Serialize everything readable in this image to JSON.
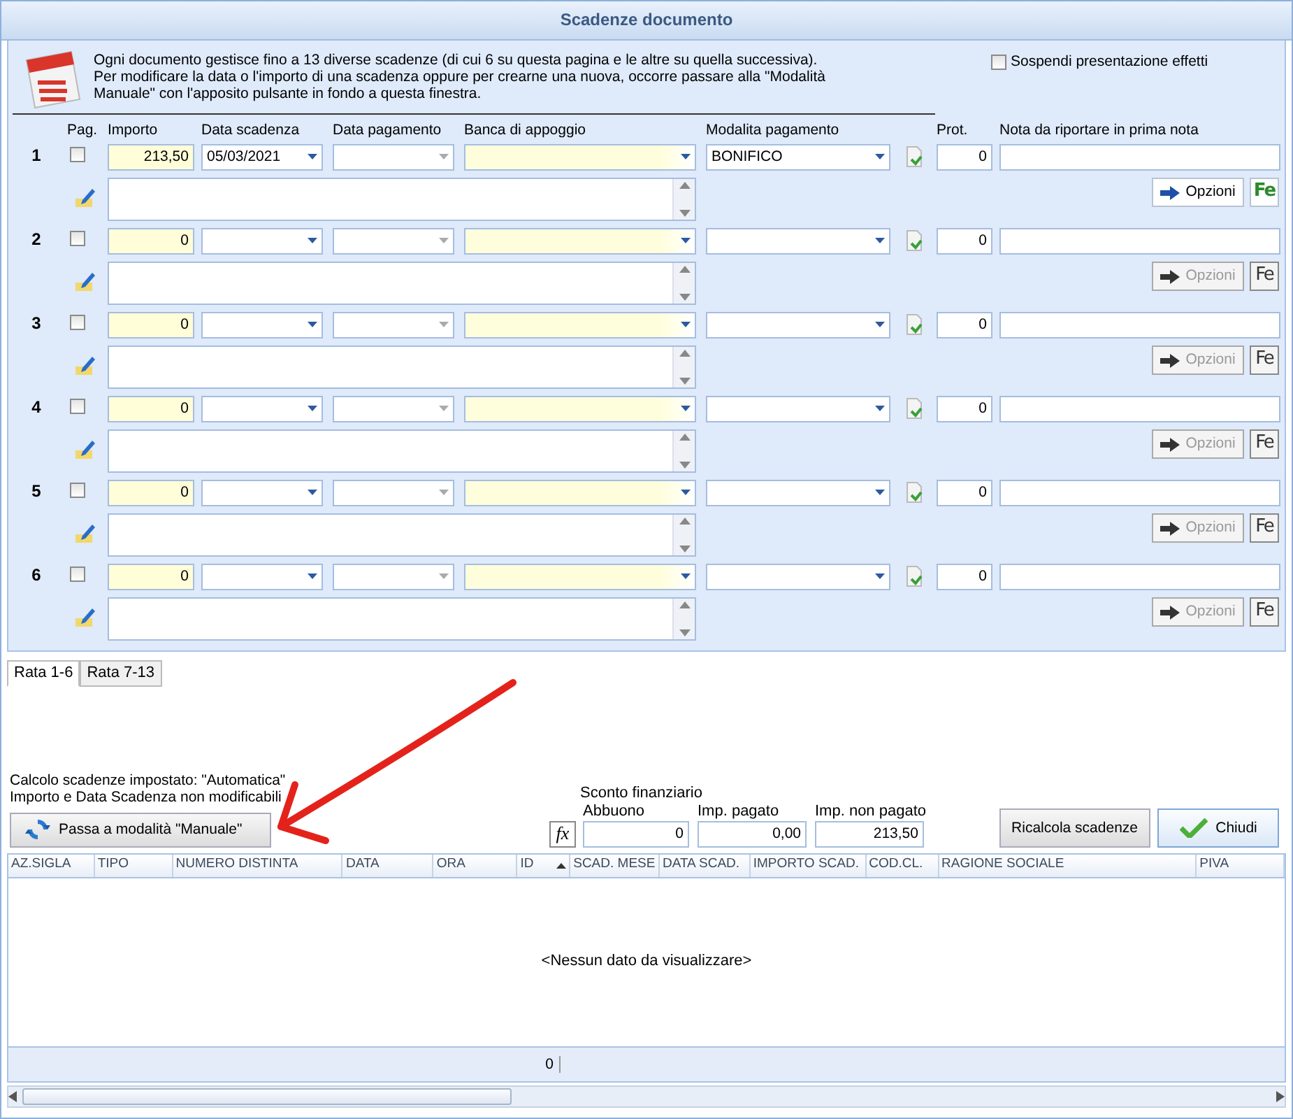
{
  "window": {
    "title": "Scadenze documento"
  },
  "info": {
    "lines": [
      "Ogni documento gestisce fino a 13 diverse scadenze (di cui 6 su questa pagina e le altre su quella successiva).",
      "Per modificare la data o l'importo di una scadenza oppure per crearne una nuova, occorre passare alla \"Modalità",
      "Manuale\" con l'apposito pulsante in fondo a questa finestra."
    ]
  },
  "suspend_checkbox": {
    "label": "Sospendi presentazione effetti",
    "checked": false
  },
  "columns": [
    "Pag.",
    "Importo",
    "Data scadenza",
    "Data pagamento",
    "Banca di appoggio",
    "Modalita pagamento",
    "Prot.",
    "Nota da riportare in prima nota"
  ],
  "rate": [
    {
      "number": "1",
      "paid": false,
      "importo": "213,50",
      "data_scadenza": "05/03/2021",
      "modalita": "BONIFICO",
      "prot": "0",
      "options": {
        "label": "Opzioni",
        "enabled": true
      },
      "fe": {
        "label": "Fe",
        "enabled": true
      }
    },
    {
      "number": "2",
      "paid": false,
      "importo": "0",
      "prot": "0",
      "options": {
        "label": "Opzioni",
        "enabled": false
      },
      "fe": {
        "label": "Fe",
        "enabled": false
      }
    },
    {
      "number": "3",
      "paid": false,
      "importo": "0",
      "prot": "0",
      "options": {
        "label": "Opzioni",
        "enabled": false
      },
      "fe": {
        "label": "Fe",
        "enabled": false
      }
    },
    {
      "number": "4",
      "paid": false,
      "importo": "0",
      "prot": "0",
      "options": {
        "label": "Opzioni",
        "enabled": false
      },
      "fe": {
        "label": "Fe",
        "enabled": false
      }
    },
    {
      "number": "5",
      "paid": false,
      "importo": "0",
      "prot": "0",
      "options": {
        "label": "Opzioni",
        "enabled": false
      },
      "fe": {
        "label": "Fe",
        "enabled": false
      }
    },
    {
      "number": "6",
      "paid": false,
      "importo": "0",
      "prot": "0",
      "options": {
        "label": "Opzioni",
        "enabled": false
      },
      "fe": {
        "label": "Fe",
        "enabled": false
      }
    }
  ],
  "tabs": [
    {
      "label": "Rata 1-6",
      "selected": true
    },
    {
      "label": "Rata 7-13",
      "selected": false
    }
  ],
  "calc_info": {
    "lines": [
      "Calcolo scadenze impostato: \"Automatica\"",
      "Importo e Data Scadenza non modificabili"
    ]
  },
  "mode_button": {
    "label": "Passa a modalità \"Manuale\""
  },
  "totals": {
    "group_label": "Sconto finanziario",
    "fx_label": "fx",
    "fields": [
      {
        "label": "Abbuono",
        "value": "0"
      },
      {
        "label": "Imp. pagato",
        "value": "0,00"
      },
      {
        "label": "Imp. non pagato",
        "value": "213,50"
      }
    ]
  },
  "buttons": [
    {
      "kind": "plain",
      "label": "Ricalcola scadenze"
    },
    {
      "kind": "check",
      "label": "Chiudi"
    }
  ],
  "grid": {
    "columns": [
      {
        "label": "AZ.SIGLA"
      },
      {
        "label": "TIPO"
      },
      {
        "label": "NUMERO DISTINTA"
      },
      {
        "label": "DATA"
      },
      {
        "label": "ORA"
      },
      {
        "label": "ID",
        "sorted": true
      },
      {
        "label": "SCAD. MESE"
      },
      {
        "label": "DATA SCAD."
      },
      {
        "label": "IMPORTO SCAD."
      },
      {
        "label": "COD.CL."
      },
      {
        "label": "RAGIONE SOCIALE"
      },
      {
        "label": "PIVA"
      }
    ],
    "empty_text": "<Nessun dato da visualizzare>",
    "footer": "0"
  }
}
